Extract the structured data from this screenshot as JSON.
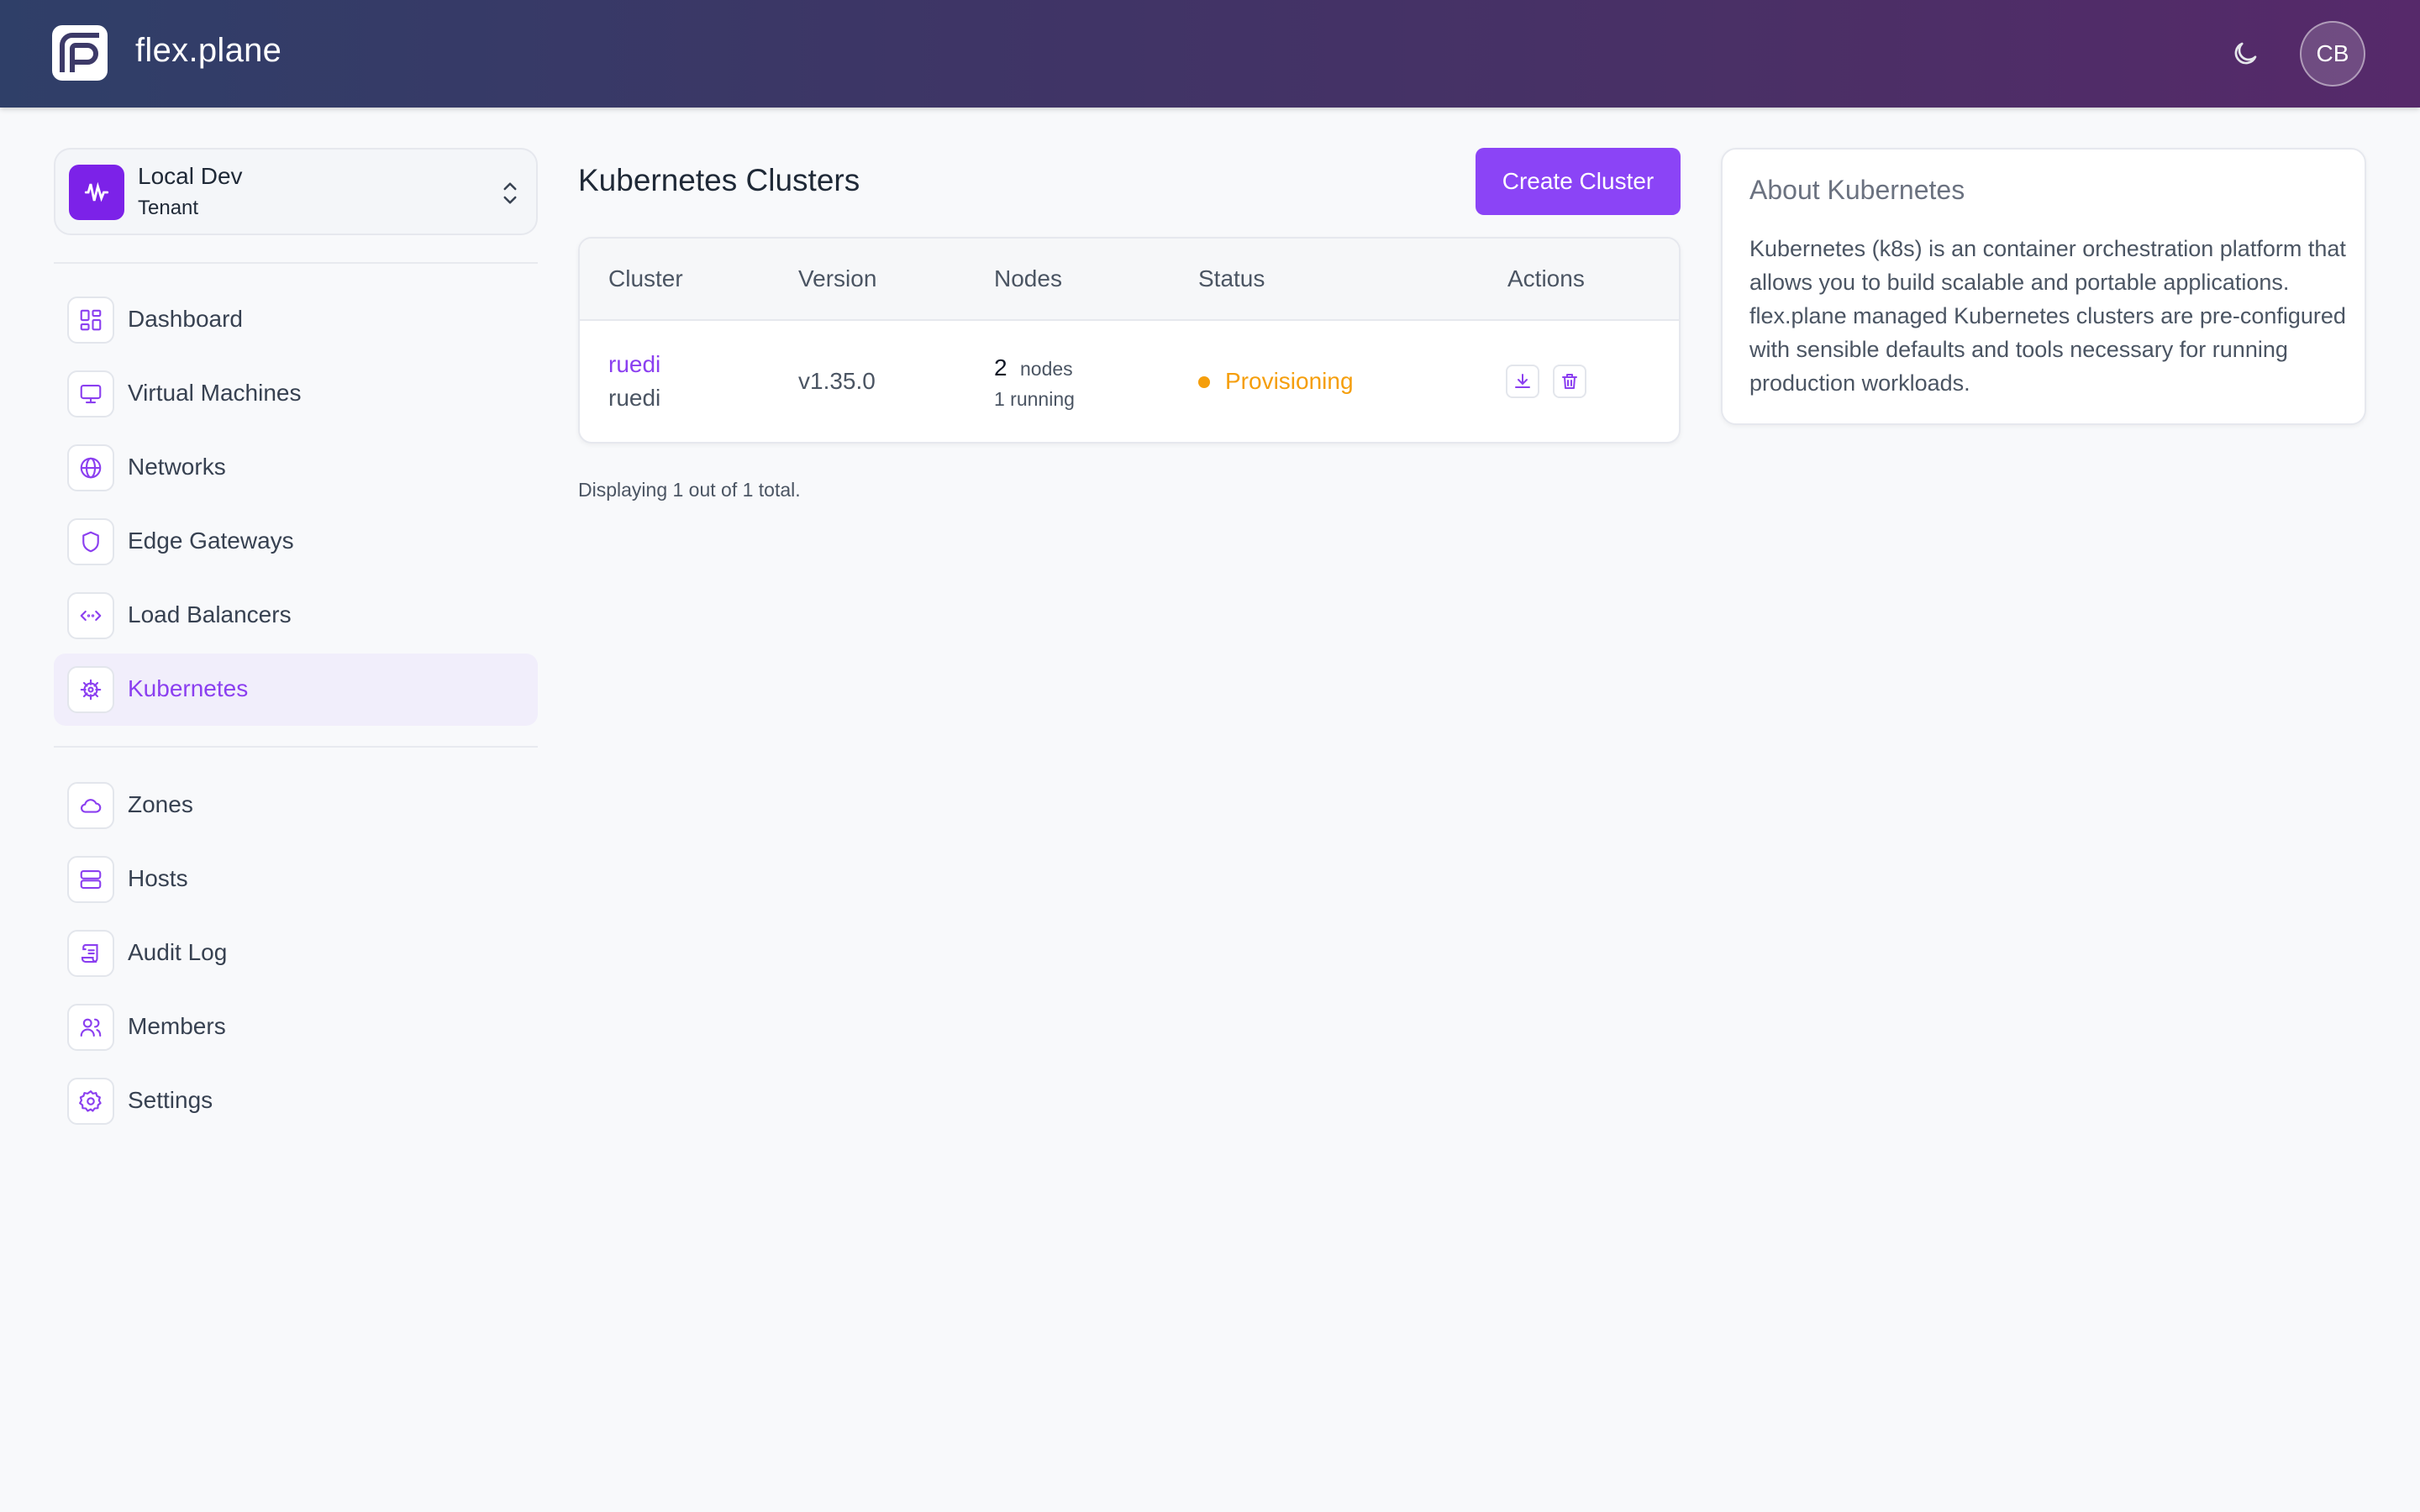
{
  "app": {
    "brand": "flex.plane",
    "user_initials": "CB"
  },
  "tenant": {
    "name": "Local Dev",
    "type": "Tenant"
  },
  "nav": {
    "primary": [
      {
        "label": "Dashboard",
        "icon": "dashboard-icon"
      },
      {
        "label": "Virtual Machines",
        "icon": "monitor-icon"
      },
      {
        "label": "Networks",
        "icon": "globe-icon"
      },
      {
        "label": "Edge Gateways",
        "icon": "shield-icon"
      },
      {
        "label": "Load Balancers",
        "icon": "code-brackets-icon"
      },
      {
        "label": "Kubernetes",
        "icon": "helm-wheel-icon",
        "active": true
      }
    ],
    "secondary": [
      {
        "label": "Zones",
        "icon": "cloud-icon"
      },
      {
        "label": "Hosts",
        "icon": "server-icon"
      },
      {
        "label": "Audit Log",
        "icon": "scroll-icon"
      },
      {
        "label": "Members",
        "icon": "users-icon"
      },
      {
        "label": "Settings",
        "icon": "gear-icon"
      }
    ]
  },
  "main": {
    "title": "Kubernetes Clusters",
    "create_label": "Create Cluster",
    "table": {
      "headers": {
        "cluster": "Cluster",
        "version": "Version",
        "nodes": "Nodes",
        "status": "Status",
        "actions": "Actions"
      },
      "rows": [
        {
          "cluster_link": "ruedi",
          "cluster_name": "ruedi",
          "version": "v1.35.0",
          "nodes_count": "2",
          "nodes_unit": "nodes",
          "nodes_running": "1 running",
          "status": "Provisioning"
        }
      ]
    },
    "count_text": "Displaying 1 out of 1 total."
  },
  "about": {
    "title": "About Kubernetes",
    "text": "Kubernetes (k8s) is an container orchestration platform that allows you to build scalable and portable applications. flex.plane managed Kubernetes clusters are pre-configured with sensible defaults and tools necessary for running production workloads."
  },
  "colors": {
    "accent": "#8b44f6",
    "status_provisioning": "#f59e0b",
    "header_from": "#2f3f68",
    "header_to": "#56296a"
  }
}
